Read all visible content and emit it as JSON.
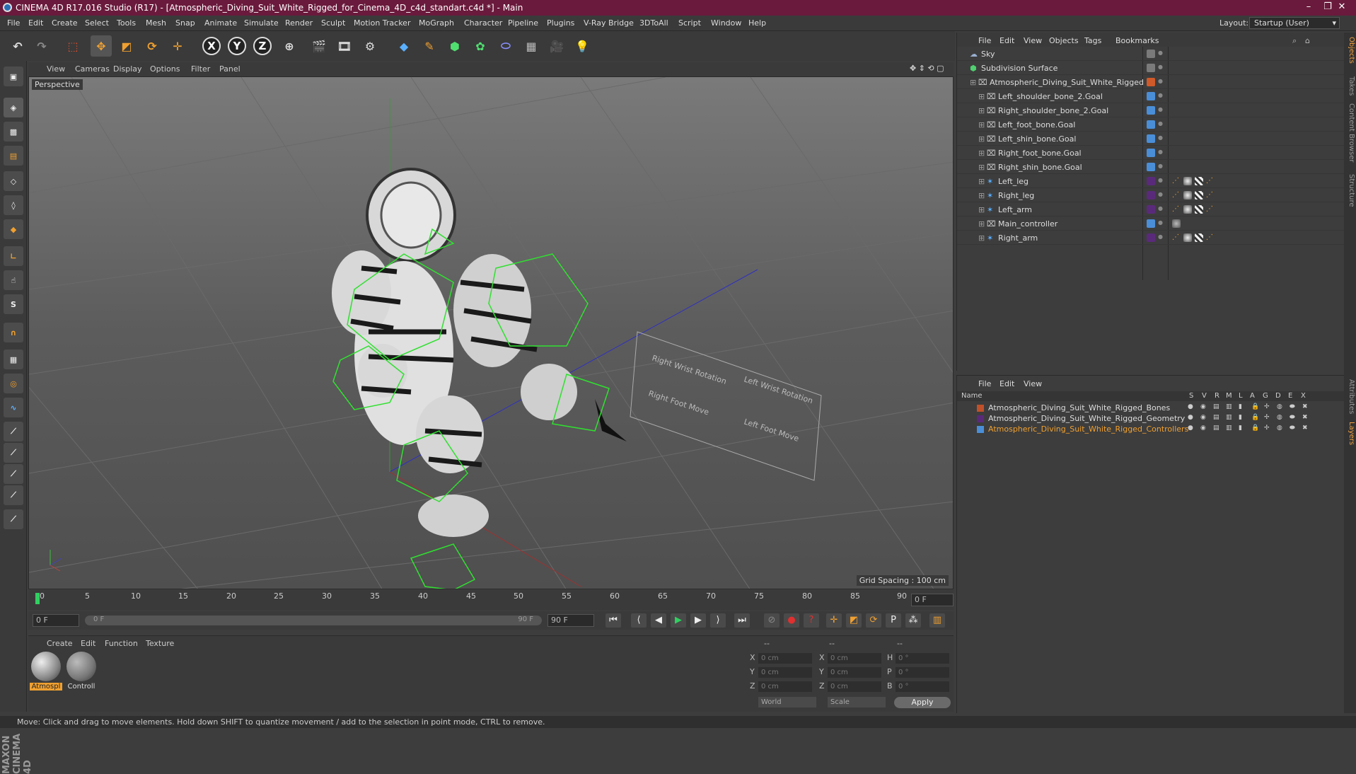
{
  "window": {
    "title": "CINEMA 4D R17.016 Studio (R17) - [Atmospheric_Diving_Suit_White_Rigged_for_Cinema_4D_c4d_standart.c4d *] - Main",
    "minimize": "–",
    "maximize": "❐",
    "close": "✕"
  },
  "menubar": {
    "items": [
      "File",
      "Edit",
      "Create",
      "Select",
      "Tools",
      "Mesh",
      "Snap",
      "Animate",
      "Simulate",
      "Render",
      "Sculpt",
      "Motion Tracker",
      "MoGraph",
      "Character",
      "Pipeline",
      "Plugins",
      "V-Ray Bridge",
      "3DToAll",
      "Script",
      "Window",
      "Help"
    ],
    "layout_label": "Layout:",
    "layout_value": "Startup (User)"
  },
  "toolbar": {
    "axis_x": "X",
    "axis_y": "Y",
    "axis_z": "Z"
  },
  "viewport": {
    "menu": [
      "View",
      "Cameras",
      "Display",
      "Options",
      "Filter",
      "Panel"
    ],
    "camera": "Perspective",
    "grid_spacing": "Grid Spacing : 100 cm",
    "panel_labels": [
      "Right Wrist Rotation",
      "Left Wrist Rotation",
      "Right Foot Move",
      "Left Foot Move"
    ]
  },
  "timeline": {
    "ticks": [
      "0",
      "5",
      "10",
      "15",
      "20",
      "25",
      "30",
      "35",
      "40",
      "45",
      "50",
      "55",
      "60",
      "65",
      "70",
      "75",
      "80",
      "85",
      "90"
    ],
    "current_frame": "0 F",
    "start": "0 F",
    "range_start": "0 F",
    "range_end": "90 F",
    "end": "90 F"
  },
  "material_panel": {
    "menu": [
      "Create",
      "Edit",
      "Function",
      "Texture"
    ],
    "materials": [
      {
        "label": "Atmospl",
        "selected": true
      },
      {
        "label": "Controll",
        "selected": false
      }
    ]
  },
  "coord_panel": {
    "headers": [
      "--",
      "--",
      "--"
    ],
    "rows": [
      {
        "l1": "X",
        "v1": "0 cm",
        "l2": "X",
        "v2": "0 cm",
        "l3": "H",
        "v3": "0 °"
      },
      {
        "l1": "Y",
        "v1": "0 cm",
        "l2": "Y",
        "v2": "0 cm",
        "l3": "P",
        "v3": "0 °"
      },
      {
        "l1": "Z",
        "v1": "0 cm",
        "l2": "Z",
        "v2": "0 cm",
        "l3": "B",
        "v3": "0 °"
      }
    ],
    "mode": "World",
    "transform": "Scale",
    "apply": "Apply"
  },
  "status": "Move: Click and drag to move elements. Hold down SHIFT to quantize movement / add to the selection in point mode, CTRL to remove.",
  "object_manager": {
    "menu": [
      "File",
      "Edit",
      "View",
      "Objects",
      "Tags",
      "Bookmarks"
    ],
    "objects": [
      {
        "name": "Sky",
        "indent": 0,
        "color": "#7a7a7a",
        "kind": "sky"
      },
      {
        "name": "Subdivision Surface",
        "indent": 0,
        "color": "#7a7a7a",
        "kind": "subd"
      },
      {
        "name": "Atmospheric_Diving_Suit_White_Rigged",
        "indent": 1,
        "color": "#d05a2a",
        "kind": "null"
      },
      {
        "name": "Left_shoulder_bone_2.Goal",
        "indent": 2,
        "color": "#4a8ed8",
        "kind": "null"
      },
      {
        "name": "Right_shoulder_bone_2.Goal",
        "indent": 2,
        "color": "#4a8ed8",
        "kind": "null"
      },
      {
        "name": "Left_foot_bone.Goal",
        "indent": 2,
        "color": "#4a8ed8",
        "kind": "null"
      },
      {
        "name": "Left_shin_bone.Goal",
        "indent": 2,
        "color": "#4a8ed8",
        "kind": "null"
      },
      {
        "name": "Right_foot_bone.Goal",
        "indent": 2,
        "color": "#4a8ed8",
        "kind": "null"
      },
      {
        "name": "Right_shin_bone.Goal",
        "indent": 2,
        "color": "#4a8ed8",
        "kind": "null"
      },
      {
        "name": "Left_leg",
        "indent": 2,
        "color": "#5a2a7a",
        "kind": "joint"
      },
      {
        "name": "Right_leg",
        "indent": 2,
        "color": "#5a2a7a",
        "kind": "joint"
      },
      {
        "name": "Left_arm",
        "indent": 2,
        "color": "#5a2a7a",
        "kind": "joint"
      },
      {
        "name": "Main_controller",
        "indent": 2,
        "color": "#4a8ed8",
        "kind": "null"
      },
      {
        "name": "Right_arm",
        "indent": 2,
        "color": "#5a2a7a",
        "kind": "joint"
      }
    ]
  },
  "layer_manager": {
    "menu": [
      "File",
      "Edit",
      "View"
    ],
    "columns": [
      "Name",
      "S",
      "V",
      "R",
      "M",
      "L",
      "A",
      "G",
      "D",
      "E",
      "X"
    ],
    "layers": [
      {
        "name": "Atmospheric_Diving_Suit_White_Rigged_Bones",
        "color": "#c0502a",
        "text_color": "#dddddd"
      },
      {
        "name": "Atmospheric_Diving_Suit_White_Rigged_Geometry",
        "color": "#5a2a7a",
        "text_color": "#dddddd"
      },
      {
        "name": "Atmospheric_Diving_Suit_White_Rigged_Controllers",
        "color": "#4a8ed8",
        "text_color": "#f0a030"
      }
    ]
  },
  "right_tabs": [
    "Objects",
    "Takes",
    "Content Browser",
    "Structure",
    "Attributes",
    "Layers"
  ]
}
